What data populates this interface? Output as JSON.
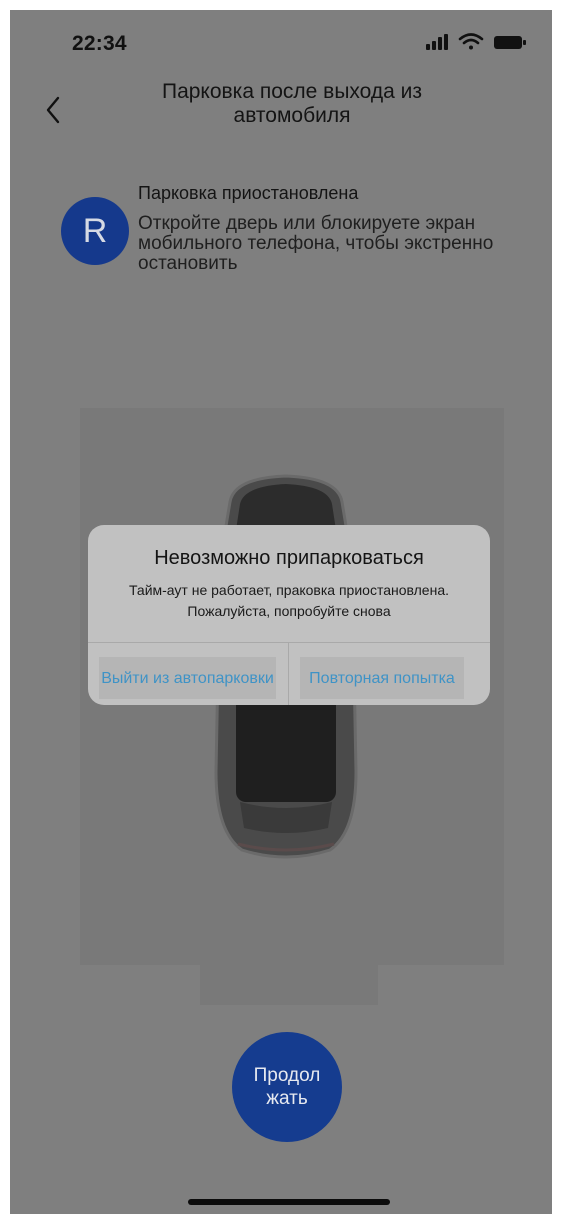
{
  "status_bar": {
    "time": "22:34",
    "icons": [
      "signal-icon",
      "wifi-icon",
      "battery-icon"
    ]
  },
  "header": {
    "back_icon": "chevron-left-icon",
    "title": "Парковка после выхода из автомобиля"
  },
  "parking_status": {
    "badge": "R",
    "title": "Парковка приостановлена",
    "description": "Откройте дверь или блокируете экран мобильного телефона, чтобы экстренно остановить"
  },
  "dialog": {
    "title": "Невозможно припарковаться",
    "message": "Тайм-аут не работает, праковка приостановлена. Пожалуйста, попробуйте снова",
    "exit_button": "Выйти из автопарковки",
    "retry_button": "Повторная попытка"
  },
  "continue_button": "Продол жать",
  "colors": {
    "overlay": "#7f7f7f",
    "accent_blue": "#153c8f",
    "dialog_button_text": "#3f93c6"
  }
}
